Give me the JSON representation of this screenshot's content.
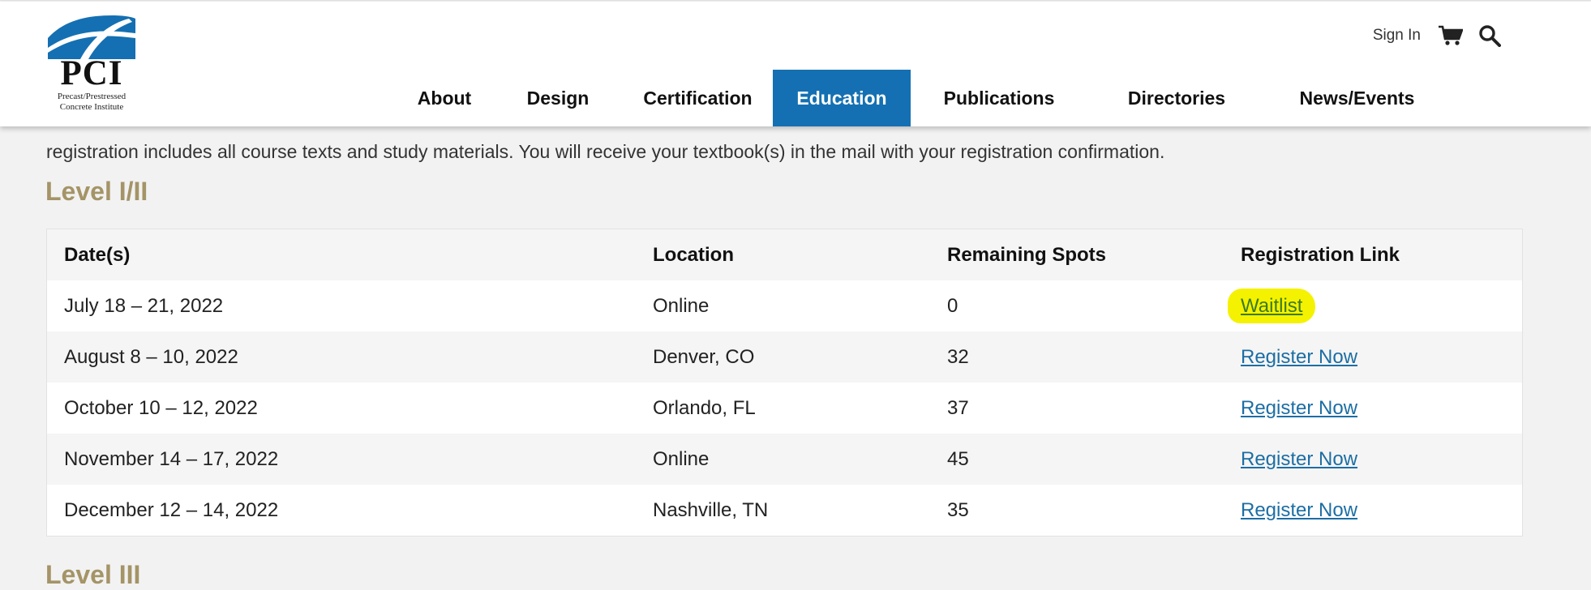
{
  "logo": {
    "text": "PCI",
    "subtitle_line1": "Precast/Prestressed",
    "subtitle_line2": "Concrete Institute",
    "colors": {
      "primary": "#1470b2",
      "dark": "#111111"
    }
  },
  "utility": {
    "sign_in": "Sign In",
    "cart_icon": "shopping-cart-icon",
    "search_icon": "search-icon"
  },
  "nav": {
    "items": [
      {
        "label": "About"
      },
      {
        "label": "Design"
      },
      {
        "label": "Certification"
      },
      {
        "label": "Education",
        "active": true
      },
      {
        "label": "Publications"
      },
      {
        "label": "Directories"
      },
      {
        "label": "News/Events"
      }
    ],
    "active_color": "#1470b2"
  },
  "intro_text": "registration includes all course texts and study materials. You will receive your textbook(s) in the mail with your registration confirmation.",
  "section_level12": {
    "title": "Level I/II",
    "table": {
      "headers": [
        "Date(s)",
        "Location",
        "Remaining Spots",
        "Registration Link"
      ],
      "rows": [
        {
          "dates": "July 18 – 21, 2022",
          "location": "Online",
          "spots": "0",
          "link": "Waitlist",
          "highlighted": true
        },
        {
          "dates": "August 8 – 10, 2022",
          "location": "Denver, CO",
          "spots": "32",
          "link": "Register Now"
        },
        {
          "dates": "October 10 – 12, 2022",
          "location": "Orlando, FL",
          "spots": "37",
          "link": "Register Now"
        },
        {
          "dates": "November 14 – 17, 2022",
          "location": "Online",
          "spots": "45",
          "link": "Register Now"
        },
        {
          "dates": "December 12 – 14, 2022",
          "location": "Nashville, TN",
          "spots": "35",
          "link": "Register Now"
        }
      ]
    }
  },
  "section_level3": {
    "title": "Level III"
  },
  "colors": {
    "heading": "#a49467",
    "link": "#1c6ea4",
    "highlight": "#f4f200",
    "page_background": "#f2f2f2"
  }
}
